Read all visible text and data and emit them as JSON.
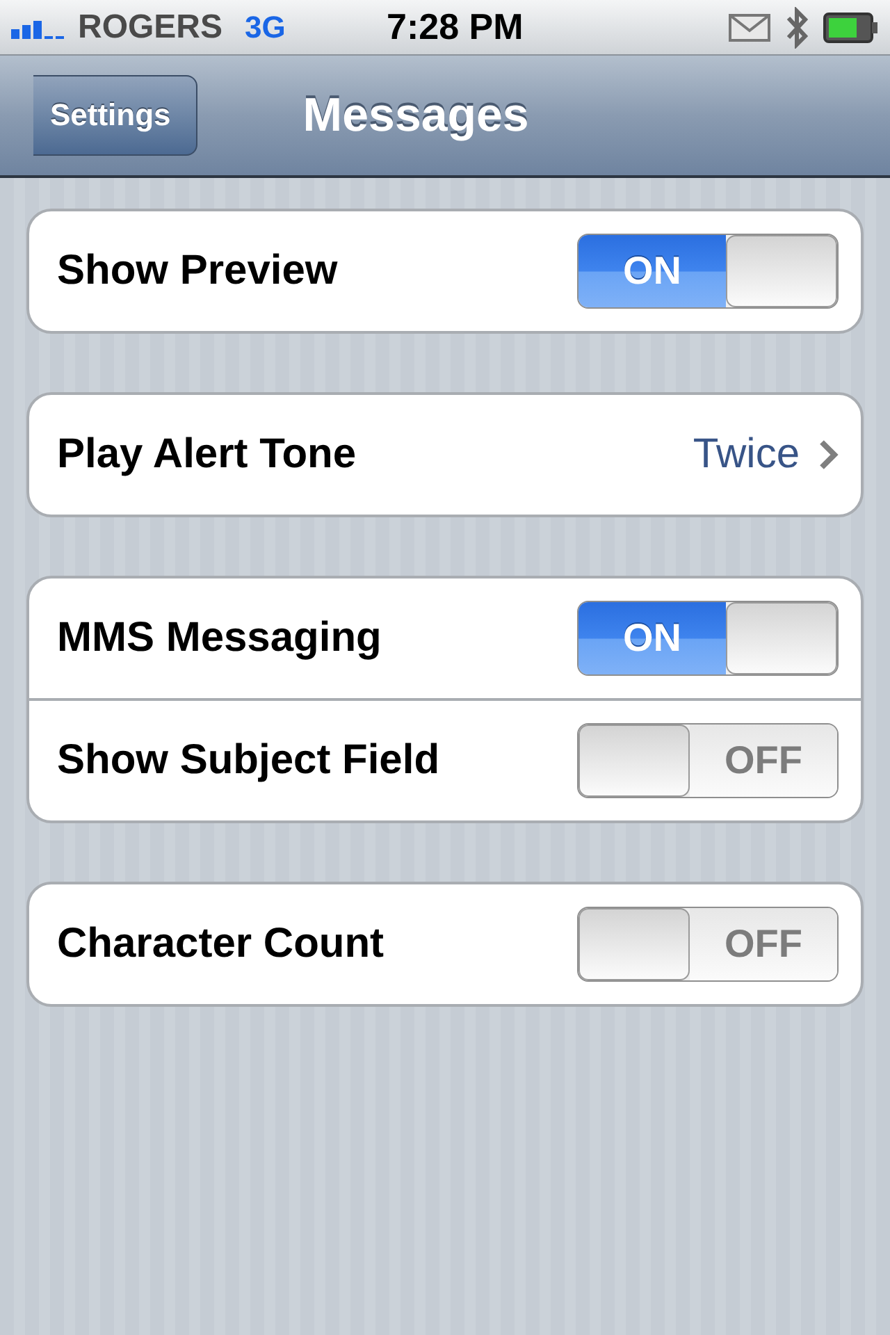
{
  "status_bar": {
    "carrier": "ROGERS",
    "network": "3G",
    "time": "7:28 PM"
  },
  "nav_bar": {
    "back_button": "Settings",
    "title": "Messages"
  },
  "groups": [
    {
      "rows": [
        {
          "kind": "switch",
          "label": "Show Preview",
          "on": true,
          "switch_text": "ON"
        }
      ]
    },
    {
      "rows": [
        {
          "kind": "disclosure",
          "label": "Play Alert Tone",
          "value": "Twice"
        }
      ]
    },
    {
      "rows": [
        {
          "kind": "switch",
          "label": "MMS Messaging",
          "on": true,
          "switch_text": "ON"
        },
        {
          "kind": "switch",
          "label": "Show Subject Field",
          "on": false,
          "switch_text": "OFF"
        }
      ]
    },
    {
      "rows": [
        {
          "kind": "switch",
          "label": "Character Count",
          "on": false,
          "switch_text": "OFF"
        }
      ]
    }
  ]
}
